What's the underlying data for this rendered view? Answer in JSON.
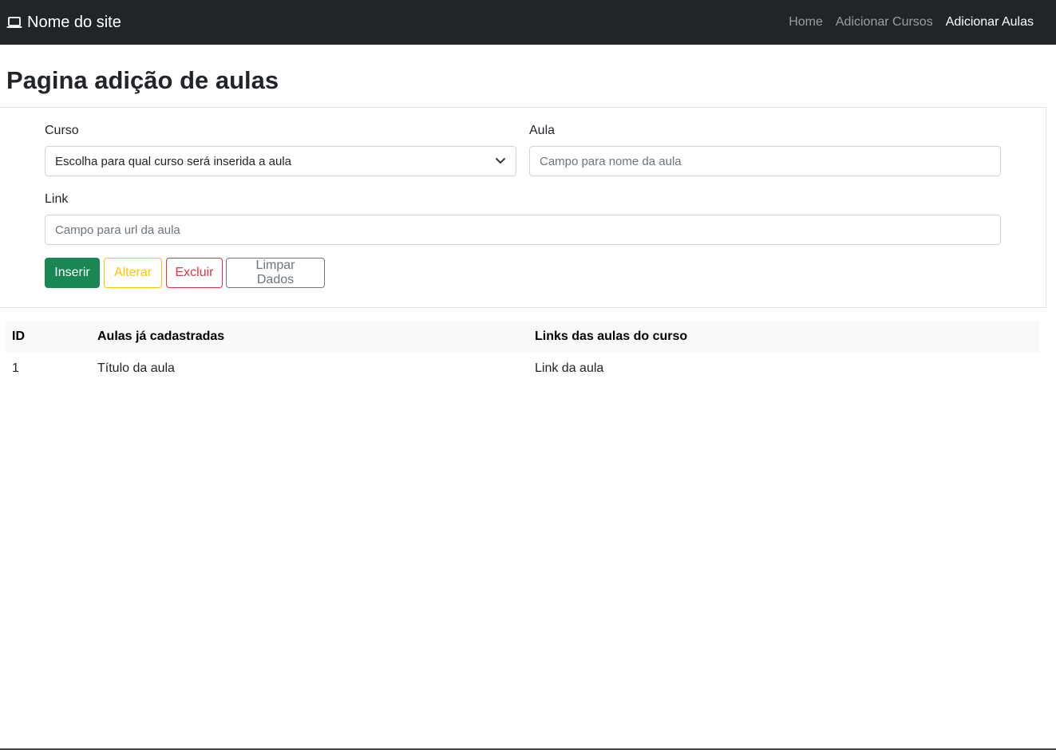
{
  "navbar": {
    "brand_icon": "laptop-icon",
    "brand_label": "Nome do site",
    "links": [
      {
        "label": "Home",
        "active": false
      },
      {
        "label": "Adicionar Cursos",
        "active": false
      },
      {
        "label": "Adicionar Aulas",
        "active": true
      }
    ]
  },
  "page": {
    "title": "Pagina adição de aulas"
  },
  "form": {
    "curso_label": "Curso",
    "curso_select_value": "Escolha para qual curso será inserida a aula",
    "aula_label": "Aula",
    "aula_placeholder": "Campo para nome da aula",
    "link_label": "Link",
    "link_placeholder": "Campo para url da aula",
    "buttons": {
      "inserir": "Inserir",
      "alterar": "Alterar",
      "excluir": "Excluir",
      "limpar": "Limpar Dados"
    }
  },
  "table": {
    "headers": [
      "ID",
      "Aulas já cadastradas",
      "Links das aulas do curso"
    ],
    "rows": [
      [
        "1",
        "Título da aula",
        "Link da aula"
      ]
    ]
  },
  "colors": {
    "navbar_bg": "#212529",
    "success": "#198754",
    "warning": "#ffc107",
    "danger": "#dc3545",
    "secondary": "#6c757d"
  }
}
